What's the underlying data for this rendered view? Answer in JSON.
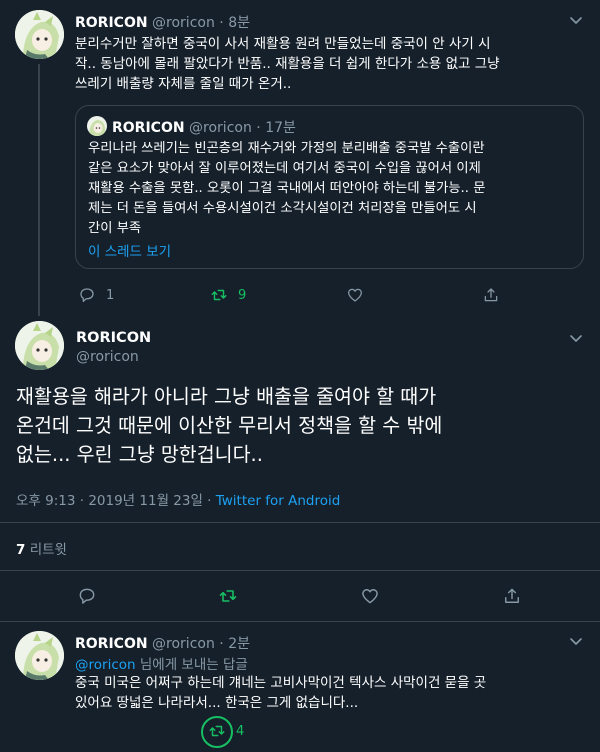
{
  "tweet1": {
    "name": "RORICON",
    "handle": "@roricon",
    "sep": "·",
    "time": "8분",
    "lines": [
      "분리수거만 잘하면 중국이 사서 재활용 원려 만들었는데 중국이 안 사기 시",
      "작.. 동남아에 몰래 팔았다가 반품.. 재활용을 더 쉽게 한다가 소용 없고 그냥",
      "쓰레기 배출량 자체를 줄일 때가 온거.."
    ],
    "quote": {
      "name": "RORICON",
      "handle": "@roricon",
      "sep": "·",
      "time": "17분",
      "lines": [
        "우리나라 쓰레기는 빈곤층의 재수거와 가정의 분리배출 중국발 수출이란",
        "같은 요소가 맞아서 잘 이루어졌는데 여기서 중국이 수입을 끊어서 이제",
        "재활용 수출을 못함.. 오롯이 그걸 국내에서 떠안아야 하는데 불가능.. 문",
        "제는 더 돈을 들여서 수용시설이건 소각시설이건 처리장을 만들어도 시",
        "간이 부족"
      ],
      "thread_link": "이 스레드 보기"
    },
    "reply_count": "1",
    "retweet_count": "9"
  },
  "main_tweet": {
    "name": "RORICON",
    "handle": "@roricon",
    "lines": [
      "재활용을 해라가 아니라 그냥 배출을 줄여야 할 때가",
      "온건데 그것 때문에 이산한 무리서 정책을 할 수 밖에",
      "없는...  우린 그냥 망한겁니다.."
    ],
    "timestamp": "오후 9:13 · 2019년 11월 23일 · ",
    "client": "Twitter for Android",
    "retweets_number": "7",
    "retweets_label": "리트윗"
  },
  "tweet3": {
    "name": "RORICON",
    "handle": "@roricon",
    "sep": "·",
    "time": "2분",
    "reply_to_handle": "@roricon",
    "reply_to_suffix": " 님에게 보내는 답글",
    "lines": [
      "중국 미국은 어쩌구 하는데 걔네는 고비사막이건 텍사스 사막이건 묻을 곳",
      "있어요 땅넓은 나라라서... 한국은 그게 없습니다..."
    ],
    "retweet_count": "4"
  },
  "icons": {
    "reply": "speech-bubble-icon",
    "retweet": "retweet-arrows-icon",
    "like": "heart-icon",
    "share": "share-upload-icon",
    "menu": "chevron-down-icon"
  },
  "colors": {
    "background": "#15202b",
    "muted": "#8899a6",
    "accent": "#1da1f2",
    "retweeted": "#17bf63",
    "border": "#38444d"
  }
}
